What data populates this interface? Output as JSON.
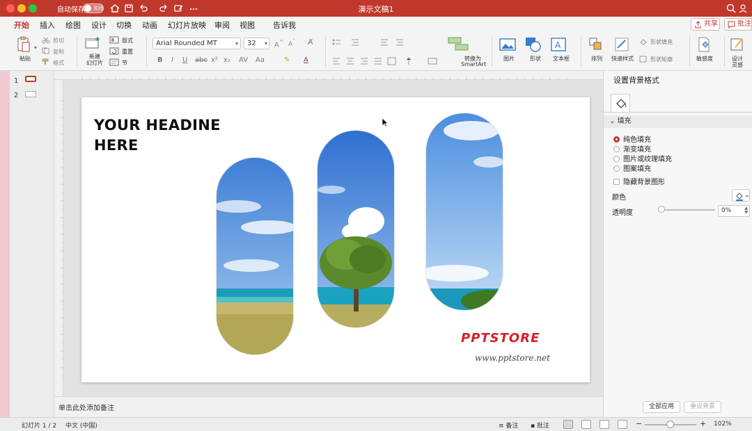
{
  "titlebar": {
    "autosave_label": "自动保存",
    "autosave_state": "关闭",
    "doc_title": "演示文稿1"
  },
  "tabs": [
    {
      "label": "开始",
      "active": true
    },
    {
      "label": "插入"
    },
    {
      "label": "绘图"
    },
    {
      "label": "设计"
    },
    {
      "label": "切换"
    },
    {
      "label": "动画"
    },
    {
      "label": "幻灯片放映"
    },
    {
      "label": "审阅"
    },
    {
      "label": "视图"
    },
    {
      "label": "告诉我"
    }
  ],
  "tab_actions": {
    "share": "共享",
    "comment": "批注"
  },
  "ribbon": {
    "paste": "粘贴",
    "cut": "剪切",
    "copy": "复制",
    "format_painter": "格式",
    "new_slide": "新建\n幻灯片",
    "layout": "版式",
    "reset": "重置",
    "section": "节",
    "font_name": "Arial Rounded MT",
    "font_size": "32",
    "convert_smartart_1": "转换为",
    "convert_smartart_2": "SmartArt",
    "picture": "图片",
    "shape": "形状",
    "textbox": "文本框",
    "arrange": "排列",
    "quick_styles": "快速样式",
    "shape_fill": "形状填充",
    "shape_outline": "形状轮廓",
    "sensitivity": "敏感度",
    "designer_1": "设计",
    "designer_2": "灵感"
  },
  "thumbnails": [
    {
      "number": "1",
      "selected": true
    },
    {
      "number": "2",
      "selected": false
    }
  ],
  "slide": {
    "headline_line1": "YOUR HEADINE",
    "headline_line2": "HERE",
    "brand": "PPTSTORE",
    "url": "www.pptstore.net"
  },
  "notes": {
    "placeholder": "单击此处添加备注"
  },
  "format_pane": {
    "title": "设置背景格式",
    "section": "填充",
    "options": [
      {
        "label": "纯色填充",
        "checked": true
      },
      {
        "label": "渐变填充",
        "checked": false
      },
      {
        "label": "图片或纹理填充",
        "checked": false
      },
      {
        "label": "图案填充",
        "checked": false
      }
    ],
    "hide_background": "隐藏背景图形",
    "color_label": "颜色",
    "transparency_label": "透明度",
    "transparency_value": "0%",
    "apply_all": "全部应用",
    "reset_background": "重设背景"
  },
  "status": {
    "slide_count": "幻灯片 1 / 2",
    "language": "中文 (中国)",
    "notes": "备注",
    "comments": "批注",
    "zoom": "102%"
  },
  "colors": {
    "accent": "#c0382b",
    "brand": "#d3232a"
  }
}
